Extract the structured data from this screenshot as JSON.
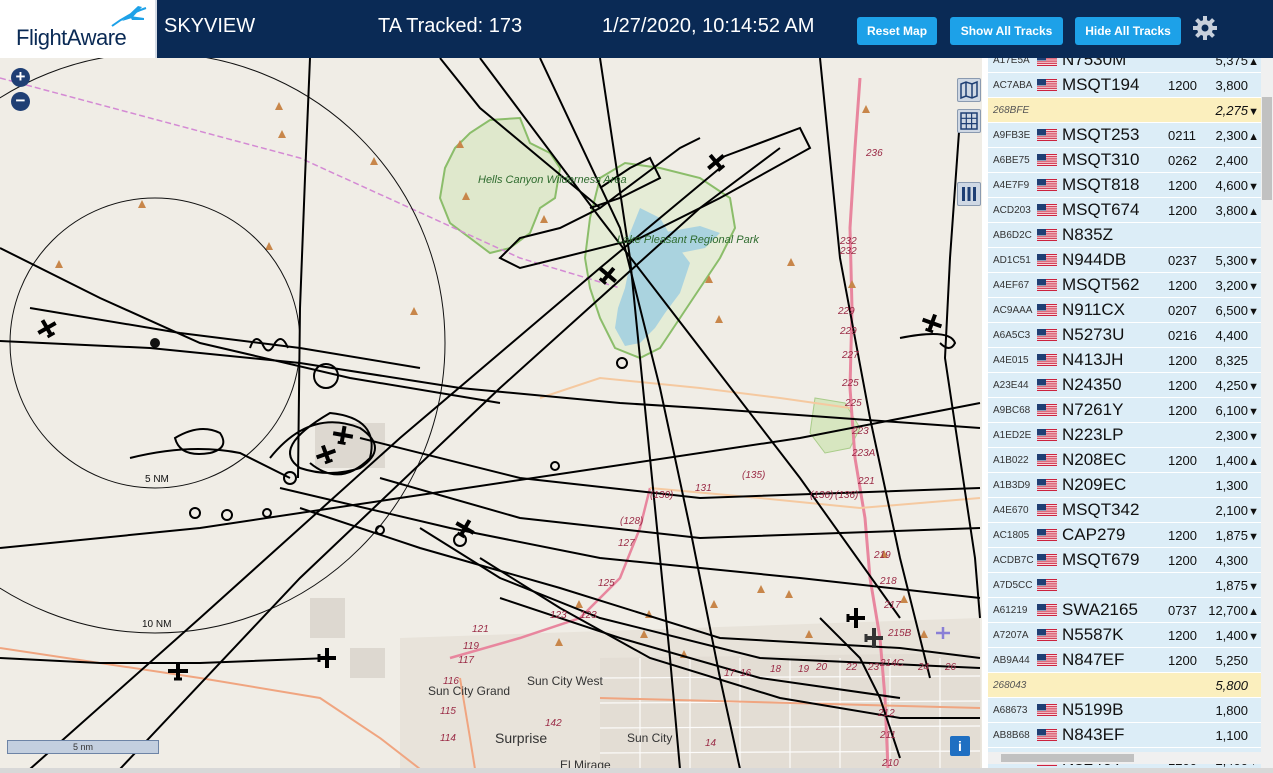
{
  "header": {
    "logo_text": "FlightAware",
    "title": "SKYVIEW",
    "tracked": "TA Tracked: 173",
    "datetime": "1/27/2020, 10:14:52 AM",
    "buttons": {
      "reset": "Reset Map",
      "show_all": "Show All Tracks",
      "hide_all": "Hide All Tracks"
    },
    "settings_icon": "gear-icon"
  },
  "map": {
    "zoom_in": "+",
    "zoom_out": "−",
    "scale_label": "5 nm",
    "info_label": "i",
    "ring_labels": {
      "inner": "5 NM",
      "outer": "10 NM"
    },
    "places": {
      "hells_canyon": "Hells Canyon Wilderness Area",
      "lake_pleasant": "Lake Pleasant Regional Park",
      "sun_city_grand": "Sun City Grand",
      "sun_city_west": "Sun City West",
      "surprise": "Surprise",
      "sun_city": "Sun City",
      "el_mirage": "El Mirage"
    },
    "road_labels": [
      "236",
      "232",
      "232",
      "229",
      "229",
      "227",
      "225",
      "225",
      "223",
      "223A",
      "221",
      "(136)",
      "(136)",
      "(135)",
      "131",
      "(130)",
      "(128)",
      "127",
      "125",
      "123",
      "123",
      "121",
      "119",
      "117",
      "116",
      "115",
      "114",
      "142",
      "14",
      "17",
      "16",
      "18",
      "19",
      "20",
      "22",
      "23",
      "24",
      "26",
      "219",
      "218",
      "217",
      "215B",
      "214C",
      "211",
      "210",
      "212"
    ],
    "colors": {
      "land": "#f0ede6",
      "water": "#aad3df",
      "park": "#c8dfa8",
      "park_border": "#8bbd6a",
      "highway": "#e8869e",
      "road": "#f5c9a0",
      "track": "#000000"
    }
  },
  "table": {
    "rows": [
      {
        "hex": "A17E5A",
        "ident": "N7530M",
        "squawk": "",
        "alt": "5,375",
        "trend": "▲",
        "flag": "us",
        "highlight": false
      },
      {
        "hex": "AC7ABA",
        "ident": "MSQT194",
        "squawk": "1200",
        "alt": "3,800",
        "trend": "",
        "flag": "us",
        "highlight": false
      },
      {
        "hex": "268BFE",
        "ident": "",
        "squawk": "",
        "alt": "2,275",
        "trend": "▼",
        "flag": "",
        "highlight": true
      },
      {
        "hex": "A9FB3E",
        "ident": "MSQT253",
        "squawk": "0211",
        "alt": "2,300",
        "trend": "▲",
        "flag": "us",
        "highlight": false
      },
      {
        "hex": "A6BE75",
        "ident": "MSQT310",
        "squawk": "0262",
        "alt": "2,400",
        "trend": "",
        "flag": "us",
        "highlight": false
      },
      {
        "hex": "A4E7F9",
        "ident": "MSQT818",
        "squawk": "1200",
        "alt": "4,600",
        "trend": "▼",
        "flag": "us",
        "highlight": false
      },
      {
        "hex": "ACD203",
        "ident": "MSQT674",
        "squawk": "1200",
        "alt": "3,800",
        "trend": "▲",
        "flag": "us",
        "highlight": false
      },
      {
        "hex": "AB6D2C",
        "ident": "N835Z",
        "squawk": "",
        "alt": "",
        "trend": "",
        "flag": "us",
        "highlight": false
      },
      {
        "hex": "AD1C51",
        "ident": "N944DB",
        "squawk": "0237",
        "alt": "5,300",
        "trend": "▼",
        "flag": "us",
        "highlight": false
      },
      {
        "hex": "A4EF67",
        "ident": "MSQT562",
        "squawk": "1200",
        "alt": "3,200",
        "trend": "▼",
        "flag": "us",
        "highlight": false
      },
      {
        "hex": "AC9AAA",
        "ident": "N911CX",
        "squawk": "0207",
        "alt": "6,500",
        "trend": "▼",
        "flag": "us",
        "highlight": false
      },
      {
        "hex": "A6A5C3",
        "ident": "N5273U",
        "squawk": "0216",
        "alt": "4,400",
        "trend": "",
        "flag": "us",
        "highlight": false
      },
      {
        "hex": "A4E015",
        "ident": "N413JH",
        "squawk": "1200",
        "alt": "8,325",
        "trend": "",
        "flag": "us",
        "highlight": false
      },
      {
        "hex": "A23E44",
        "ident": "N24350",
        "squawk": "1200",
        "alt": "4,250",
        "trend": "▼",
        "flag": "us",
        "highlight": false
      },
      {
        "hex": "A9BC68",
        "ident": "N7261Y",
        "squawk": "1200",
        "alt": "6,100",
        "trend": "▼",
        "flag": "us",
        "highlight": false
      },
      {
        "hex": "A1ED2E",
        "ident": "N223LP",
        "squawk": "",
        "alt": "2,300",
        "trend": "▼",
        "flag": "us",
        "highlight": false
      },
      {
        "hex": "A1B022",
        "ident": "N208EC",
        "squawk": "1200",
        "alt": "1,400",
        "trend": "▲",
        "flag": "us",
        "highlight": false
      },
      {
        "hex": "A1B3D9",
        "ident": "N209EC",
        "squawk": "",
        "alt": "1,300",
        "trend": "",
        "flag": "us",
        "highlight": false
      },
      {
        "hex": "A4E670",
        "ident": "MSQT342",
        "squawk": "",
        "alt": "2,100",
        "trend": "▼",
        "flag": "us",
        "highlight": false
      },
      {
        "hex": "AC1805",
        "ident": "CAP279",
        "squawk": "1200",
        "alt": "1,875",
        "trend": "▼",
        "flag": "us",
        "highlight": false
      },
      {
        "hex": "ACDB7C",
        "ident": "MSQT679",
        "squawk": "1200",
        "alt": "4,300",
        "trend": "",
        "flag": "us",
        "highlight": false
      },
      {
        "hex": "A7D5CC",
        "ident": "",
        "squawk": "",
        "alt": "1,875",
        "trend": "▼",
        "flag": "us",
        "highlight": false
      },
      {
        "hex": "A61219",
        "ident": "SWA2165",
        "squawk": "0737",
        "alt": "12,700",
        "trend": "▲",
        "flag": "us",
        "highlight": false
      },
      {
        "hex": "A7207A",
        "ident": "N5587K",
        "squawk": "1200",
        "alt": "1,400",
        "trend": "▼",
        "flag": "us",
        "highlight": false
      },
      {
        "hex": "AB9A44",
        "ident": "N847EF",
        "squawk": "1200",
        "alt": "5,250",
        "trend": "",
        "flag": "us",
        "highlight": false
      },
      {
        "hex": "268043",
        "ident": "",
        "squawk": "",
        "alt": "5,800",
        "trend": "",
        "flag": "",
        "highlight": true
      },
      {
        "hex": "A68673",
        "ident": "N5199B",
        "squawk": "",
        "alt": "1,800",
        "trend": "",
        "flag": "us",
        "highlight": false
      },
      {
        "hex": "AB8B68",
        "ident": "N843EF",
        "squawk": "",
        "alt": "1,100",
        "trend": "",
        "flag": "us",
        "highlight": false
      },
      {
        "hex": "AB4221",
        "ident": "N8240T",
        "squawk": "1200",
        "alt": "2,400",
        "trend": "▼",
        "flag": "us",
        "highlight": false
      }
    ]
  }
}
